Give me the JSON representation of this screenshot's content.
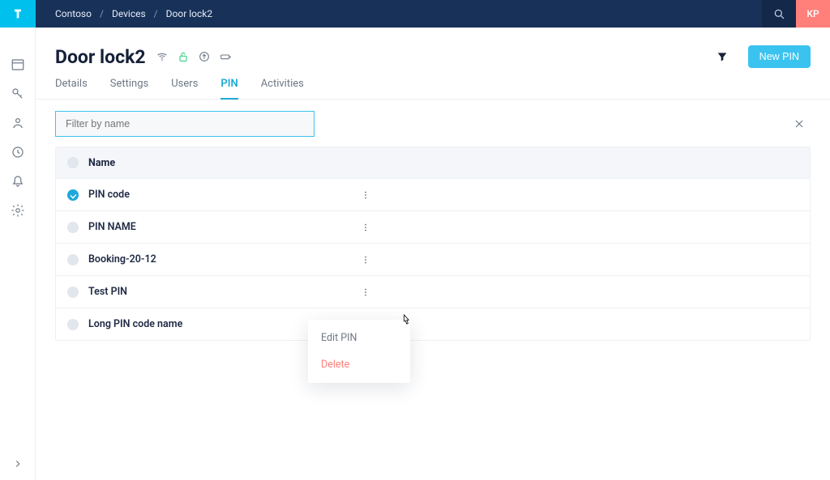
{
  "breadcrumbs": [
    "Contoso",
    "Devices",
    "Door lock2"
  ],
  "user_initials": "KP",
  "page_title": "Door lock2",
  "header_icons": [
    "wifi-icon",
    "lock-open-icon",
    "firmware-upload-icon",
    "battery-icon"
  ],
  "buttons": {
    "new_pin": "New PIN"
  },
  "tabs": {
    "items": [
      "Details",
      "Settings",
      "Users",
      "PIN",
      "Activities"
    ],
    "active_index": 3
  },
  "filter": {
    "placeholder": "Filter by name",
    "value": ""
  },
  "grid": {
    "header": {
      "name_col": "Name"
    },
    "rows": [
      {
        "name": "PIN code",
        "selected": true
      },
      {
        "name": "PIN NAME",
        "selected": false
      },
      {
        "name": "Booking-20-12",
        "selected": false
      },
      {
        "name": "Test PIN",
        "selected": false
      },
      {
        "name": "Long PIN code name",
        "selected": false
      }
    ]
  },
  "context_menu": {
    "visible_for_row": 4,
    "items": [
      {
        "label": "Edit PIN",
        "danger": false
      },
      {
        "label": "Delete",
        "danger": true
      }
    ]
  }
}
